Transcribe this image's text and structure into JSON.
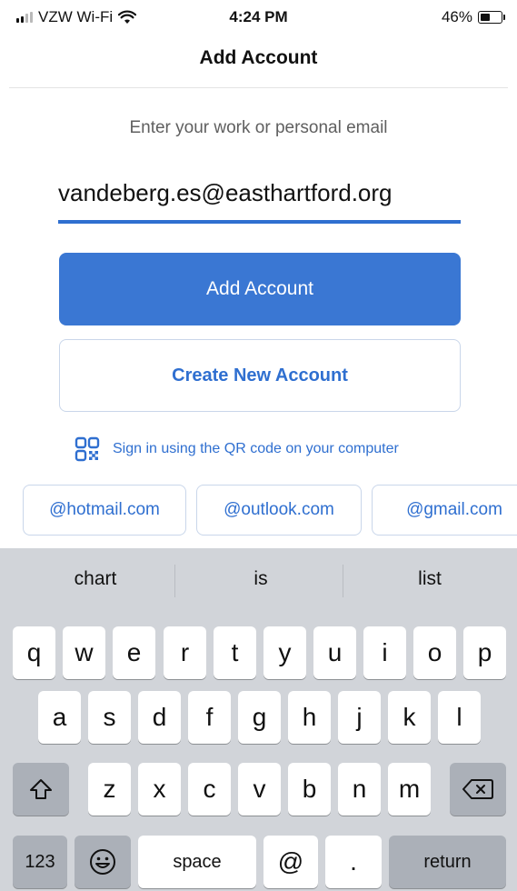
{
  "status_bar": {
    "carrier": "VZW Wi-Fi",
    "time": "4:24 PM",
    "battery_percent": "46%",
    "battery_level": 0.46,
    "icons": [
      "signal-icon",
      "wifi-icon",
      "battery-icon"
    ]
  },
  "nav": {
    "title": "Add Account"
  },
  "form": {
    "prompt": "Enter your work or personal email",
    "email_value": "vandeberg.es@easthartford.org",
    "primary_button": "Add Account",
    "secondary_button": "Create New Account",
    "qr_link": "Sign in using the QR code on your computer"
  },
  "domain_suggestions": [
    "@hotmail.com",
    "@outlook.com",
    "@gmail.com"
  ],
  "keyboard": {
    "suggestions": [
      "chart",
      "is",
      "list"
    ],
    "row1": [
      "q",
      "w",
      "e",
      "r",
      "t",
      "y",
      "u",
      "i",
      "o",
      "p"
    ],
    "row2": [
      "a",
      "s",
      "d",
      "f",
      "g",
      "h",
      "j",
      "k",
      "l"
    ],
    "row3": [
      "z",
      "x",
      "c",
      "v",
      "b",
      "n",
      "m"
    ],
    "numbers_key": "123",
    "emoji_key": "😀",
    "space_key": "space",
    "at_key": "@",
    "period_key": ".",
    "return_key": "return"
  },
  "colors": {
    "accent": "#3a77d3",
    "link": "#2f6fd0",
    "keyboard_bg": "#d1d4d9",
    "key_dark": "#abb0b8"
  }
}
